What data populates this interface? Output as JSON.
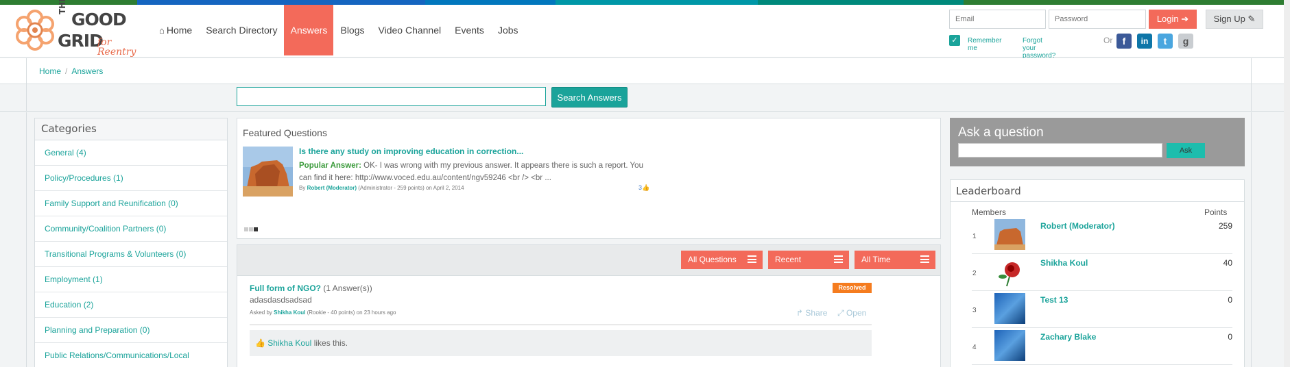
{
  "colors": {
    "accent_coral": "#f36a5a",
    "teal": "#1aa39a",
    "resolved_orange": "#f57c1f",
    "stripe": [
      "#2e7d32",
      "#1565c0",
      "#0277bd",
      "#00897b",
      "#2e7d32"
    ]
  },
  "logo": {
    "the": "THE",
    "good": "GOOD",
    "grid": "GRID",
    "tagline": "for Reentry"
  },
  "nav": {
    "home": "Home",
    "items": [
      "Search Directory",
      "Answers",
      "Blogs",
      "Video Channel",
      "Events",
      "Jobs"
    ],
    "active": "Answers"
  },
  "auth": {
    "email_placeholder": "Email",
    "password_placeholder": "Password",
    "login": "Login",
    "signup": "Sign Up",
    "remember": "Remember me",
    "forgot": "Forgot your password?",
    "or": "Or",
    "social": [
      "facebook-icon",
      "linkedin-icon",
      "twitter-icon",
      "google-icon"
    ]
  },
  "breadcrumb": [
    "Home",
    "Answers"
  ],
  "search": {
    "button": "Search Answers"
  },
  "categories": {
    "title": "Categories",
    "items": [
      "General (4)",
      "Policy/Procedures (1)",
      "Family Support and Reunification (0)",
      "Community/Coalition Partners (0)",
      "Transitional Programs & Volunteers (0)",
      "Employment (1)",
      "Education (2)",
      "Planning and Preparation (0)",
      "Public Relations/Communications/Local"
    ]
  },
  "featured": {
    "title": "Featured Questions",
    "question": "Is there any study on improving education in correction...",
    "popular_label": "Popular Answer:",
    "answer": "OK- I was wrong with my previous answer. It appears there is such a report. You can find it here: http://www.voced.edu.au/content/ngv59246 <br /> <br ...",
    "by_prefix": "By",
    "author": "Robert (Moderator)",
    "author_meta": "(Administrator - 259 points)",
    "date": "on April 2, 2014",
    "likes": "3"
  },
  "filters": [
    "All Questions",
    "Recent",
    "All Time"
  ],
  "question": {
    "title": "Full form of NGO?",
    "count": "(1 Answer(s))",
    "badge": "Resolved",
    "body": "adasdasdsadsad",
    "asked_by": "Asked by",
    "author": "Shikha Koul",
    "meta": "(Rookie - 40 points)",
    "time": "on 23 hours ago",
    "share": "Share",
    "open": "Open",
    "like_user": "Shikha Koul",
    "like_text": "likes this."
  },
  "ask": {
    "title": "Ask a question",
    "button": "Ask"
  },
  "leaderboard": {
    "title": "Leaderboard",
    "col_members": "Members",
    "col_points": "Points",
    "rows": [
      {
        "rank": "1",
        "name": "Robert (Moderator)",
        "points": "259"
      },
      {
        "rank": "2",
        "name": "Shikha Koul",
        "points": "40"
      },
      {
        "rank": "3",
        "name": "Test 13",
        "points": "0"
      },
      {
        "rank": "4",
        "name": "Zachary Blake",
        "points": "0"
      }
    ]
  }
}
